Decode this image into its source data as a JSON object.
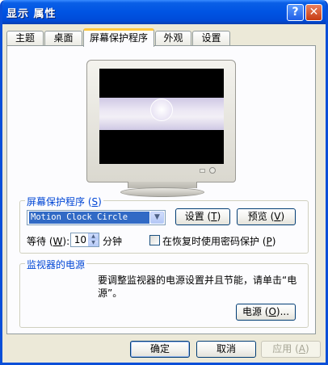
{
  "window": {
    "title": "显示 属性",
    "help_glyph": "?",
    "close_glyph": "✕"
  },
  "tabs": [
    {
      "label": "主题",
      "active": false
    },
    {
      "label": "桌面",
      "active": false
    },
    {
      "label": "屏幕保护程序",
      "active": true
    },
    {
      "label": "外观",
      "active": false
    },
    {
      "label": "设置",
      "active": false
    }
  ],
  "screensaver": {
    "group_label": "屏幕保护程序",
    "group_accel": "S",
    "selected": "Motion Clock Circle",
    "settings_label": "设置",
    "settings_accel": "T",
    "preview_label": "预览",
    "preview_accel": "V",
    "wait_label": "等待",
    "wait_accel": "W",
    "wait_value": "10",
    "minutes_label": "分钟",
    "password_label": "在恢复时使用密码保护",
    "password_accel": "P",
    "password_checked": false
  },
  "power": {
    "group_label": "监视器的电源",
    "description": "要调整监视器的电源设置并且节能，请单击“电源”。",
    "button_label": "电源",
    "button_accel": "O"
  },
  "footer": {
    "ok_label": "确定",
    "cancel_label": "取消",
    "apply_label": "应用",
    "apply_accel": "A"
  },
  "colors": {
    "titlebar": "#0054e3",
    "group_title": "#0046d5",
    "selection": "#316ac5",
    "tab_highlight": "#ffc83c"
  }
}
